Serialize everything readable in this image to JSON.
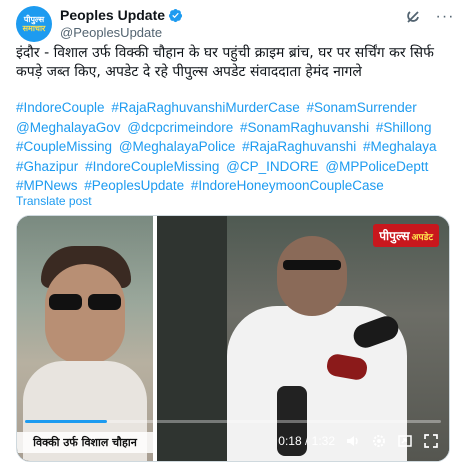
{
  "header": {
    "display_name": "Peoples Update",
    "handle": "@PeoplesUpdate",
    "avatar_text_line1": "पीपुल्स",
    "avatar_text_line2": "समाचार",
    "icons": [
      "verified-badge-icon",
      "grok-icon",
      "more-icon"
    ]
  },
  "tweet": {
    "text": "इंदौर - विशाल उर्फ विक्की चौहान के घर पहुंची क्राइम ब्रांच, घर पर सर्चिंग कर सिर्फ कपड़े जब्त किए, अपडेट दे रहे पीपुल्स अपडेट संवाददाता हेमंद नागले",
    "hashtags": [
      "#IndoreCouple",
      "#RajaRaghuvanshiMurderCase",
      "#SonamSurrender",
      "@MeghalayaGov",
      "@dcpcrimeindore",
      "#SonamRaghuvanshi",
      "#Shillong",
      "#CoupleMissing",
      "@MeghalayaPolice",
      "#RajaRaghuvanshi",
      "#Meghalaya",
      "#Ghazipur",
      "#IndoreCoupleMissing",
      "@CP_INDORE",
      "@MPPoliceDeptt",
      "#MPNews",
      "#PeoplesUpdate",
      "#IndoreHoneymoonCoupleCase"
    ],
    "translate_label": "Translate post"
  },
  "media": {
    "left_caption": "विक्की उर्फ विशाल चौहान",
    "brand_badge": "पीपुल्स",
    "brand_badge_suffix": "अपडेट",
    "time_display": "0:18 / 1:32",
    "progress_fraction": 0.196,
    "colors": {
      "accent": "#1d9bf0",
      "badge": "#c8171d"
    }
  }
}
